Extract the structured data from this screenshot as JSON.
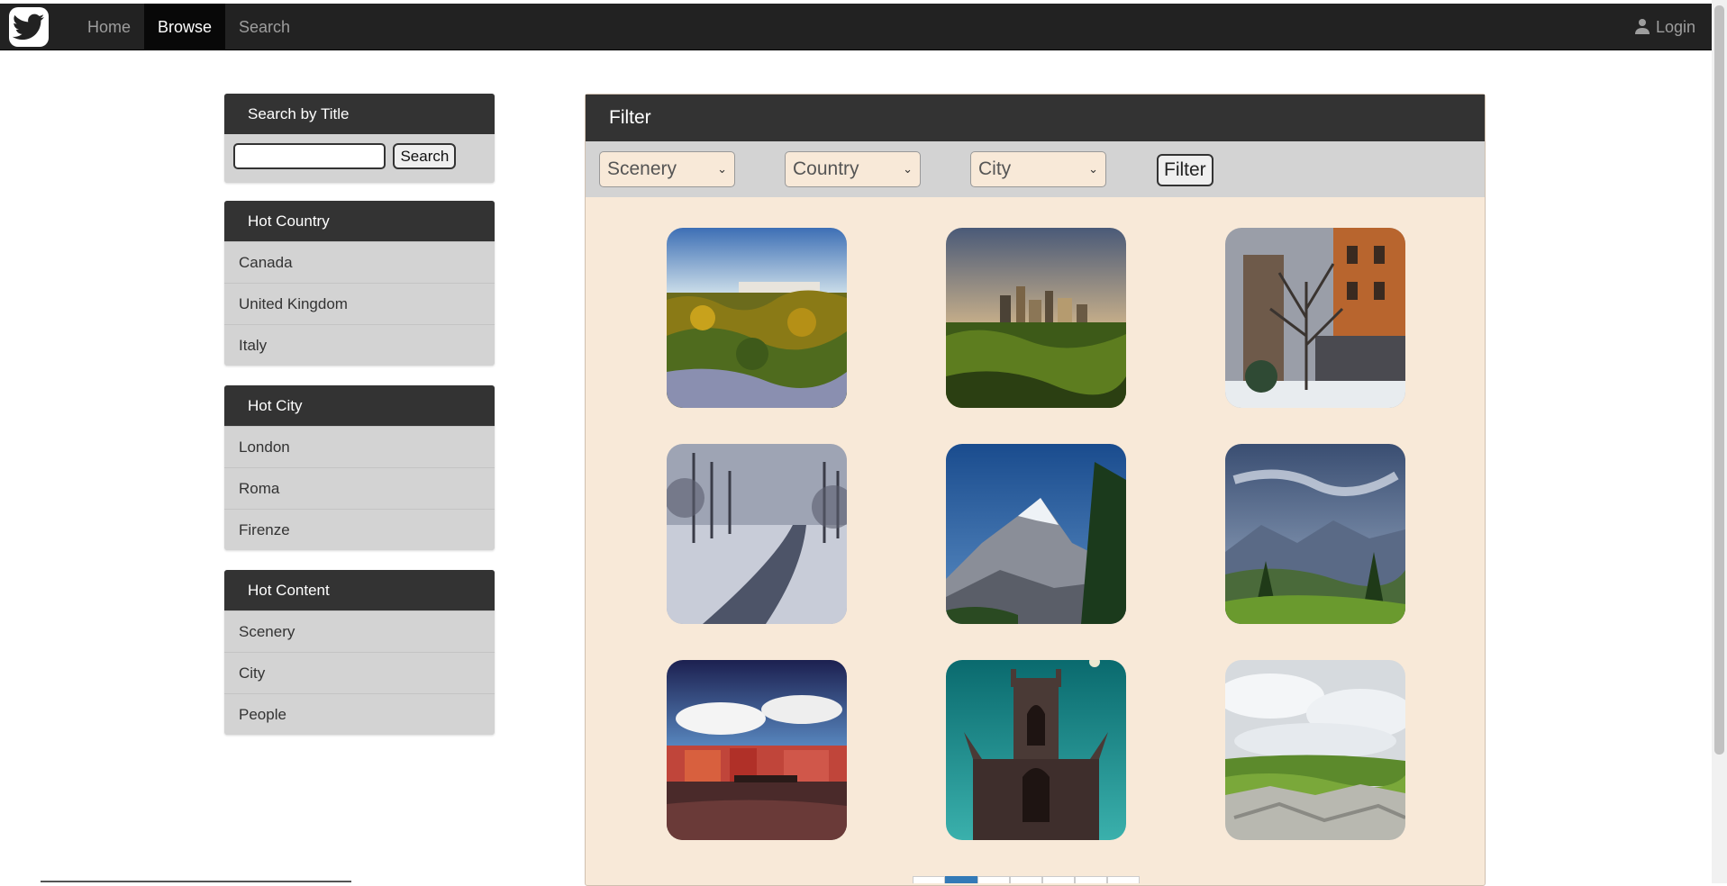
{
  "navbar": {
    "items": [
      {
        "label": "Home",
        "active": false
      },
      {
        "label": "Browse",
        "active": true
      },
      {
        "label": "Search",
        "active": false
      }
    ],
    "login_label": "Login",
    "logo_icon": "bird-logo-icon",
    "user_icon": "user-icon"
  },
  "sidebar": {
    "search_panel": {
      "title": "Search by Title",
      "input_value": "",
      "button_label": "Search"
    },
    "hot_country": {
      "title": "Hot Country",
      "items": [
        "Canada",
        "United Kingdom",
        "Italy"
      ]
    },
    "hot_city": {
      "title": "Hot City",
      "items": [
        "London",
        "Roma",
        "Firenze"
      ]
    },
    "hot_content": {
      "title": "Hot Content",
      "items": [
        "Scenery",
        "City",
        "People"
      ]
    }
  },
  "filter": {
    "title": "Filter",
    "selects": [
      {
        "name": "content-select",
        "value": "Scenery"
      },
      {
        "name": "country-select",
        "value": "Country"
      },
      {
        "name": "city-select",
        "value": "City"
      }
    ],
    "button_label": "Filter"
  },
  "gallery": {
    "images": [
      {
        "name": "photo-autumn-forest-buildings"
      },
      {
        "name": "photo-city-skyline-forest"
      },
      {
        "name": "photo-snowy-brick-building"
      },
      {
        "name": "photo-snowy-path"
      },
      {
        "name": "photo-mountain-peak"
      },
      {
        "name": "photo-mountain-valley"
      },
      {
        "name": "photo-harbor-red-buildings"
      },
      {
        "name": "photo-gothic-church"
      },
      {
        "name": "photo-rocky-coast-clouds"
      }
    ]
  },
  "pagination": {
    "active_page": 2
  },
  "colors": {
    "navbar": "#222222",
    "panel_header": "#333333",
    "panel_body": "#d3d3d3",
    "filter_bg": "#f8e9d8",
    "pager_active": "#337ab7"
  }
}
